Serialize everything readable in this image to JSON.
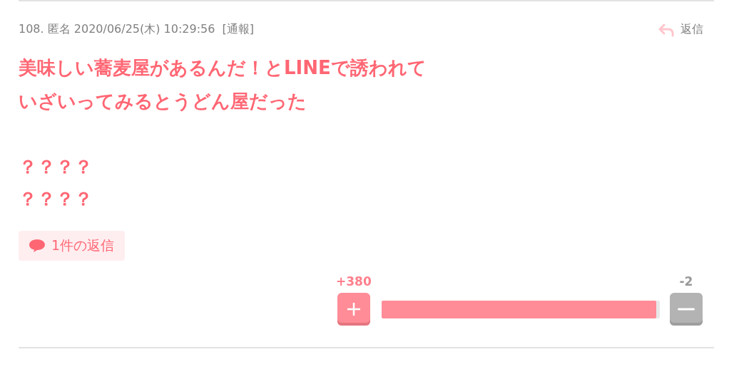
{
  "post": {
    "header": "108. 匿名 2020/06/25(木) 10:29:56",
    "report_link": "[通報]",
    "reply_button": "返信",
    "title_lines": [
      "美味しい蕎麦屋があるんだ！とLINEで誘われて",
      "いざいってみるとうどん屋だった"
    ],
    "body_lines": [
      "？？？？",
      "？？？？"
    ],
    "replies_badge": "1件の返信",
    "votes": {
      "plus_count": "+380",
      "minus_count": "-2",
      "level": 0.987
    }
  }
}
